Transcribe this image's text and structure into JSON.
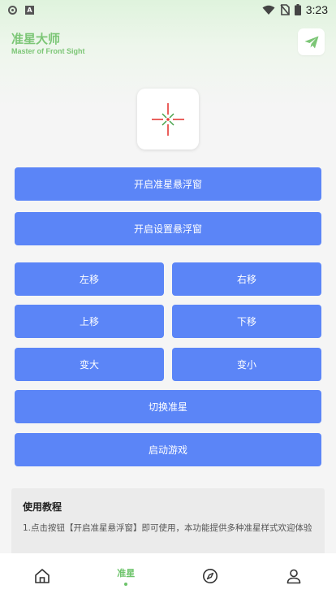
{
  "status_bar": {
    "time": "3:23",
    "icons": [
      "notification-circle-icon",
      "a-app-icon",
      "wifi-icon",
      "no-sim-icon",
      "battery-icon"
    ]
  },
  "header": {
    "title": "准星大师",
    "subtitle": "Master of Front Sight",
    "action_icon": "send-icon"
  },
  "crosshair": {
    "icon": "crosshair-icon",
    "colors": [
      "#e53935",
      "#43a047"
    ]
  },
  "buttons": {
    "open_crosshair_float": "开启准星悬浮窗",
    "open_settings_float": "开启设置悬浮窗",
    "move_left": "左移",
    "move_right": "右移",
    "move_up": "上移",
    "move_down": "下移",
    "enlarge": "变大",
    "shrink": "变小",
    "switch_crosshair": "切换准星",
    "launch_game": "启动游戏"
  },
  "tutorial": {
    "title": "使用教程",
    "text": "1.点击按钮【开启准星悬浮窗】即可使用，本功能提供多种准星样式欢迎体验"
  },
  "bottom_nav": {
    "items": [
      {
        "icon": "home-icon"
      },
      {
        "label": "准星",
        "active": true
      },
      {
        "icon": "compass-icon"
      },
      {
        "icon": "user-icon"
      }
    ]
  },
  "colors": {
    "accent_green": "#7cc676",
    "button_blue": "#5b85f7",
    "background": "#f5f5f5"
  }
}
